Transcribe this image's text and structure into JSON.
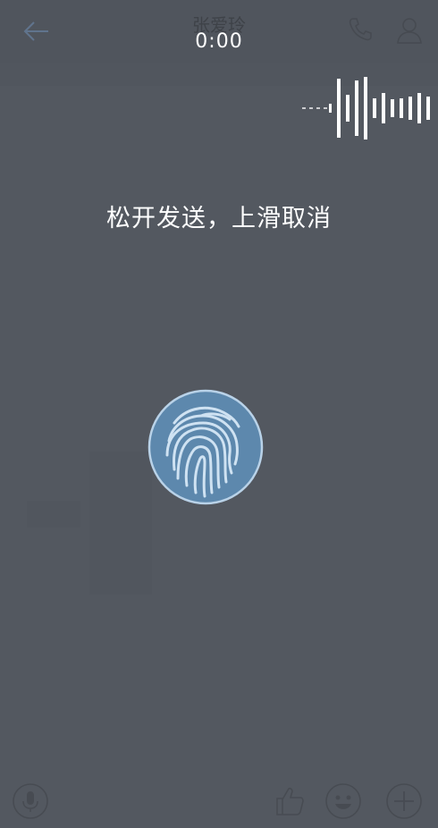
{
  "header": {
    "contact_name": "张爱玲"
  },
  "recording": {
    "timer": "0:00",
    "hint": "松开发送，上滑取消"
  },
  "colors": {
    "overlay": "#535860",
    "text": "#ffffff",
    "fingerprint_bg": "#5d88ad",
    "fingerprint_lines": "#cfe2f2"
  },
  "icons": {
    "back": "arrow-left-icon",
    "call": "phone-icon",
    "profile": "user-icon",
    "voice": "microphone-icon",
    "like": "thumbs-up-icon",
    "emoji": "smiley-icon",
    "more": "plus-icon",
    "record": "fingerprint-icon"
  }
}
